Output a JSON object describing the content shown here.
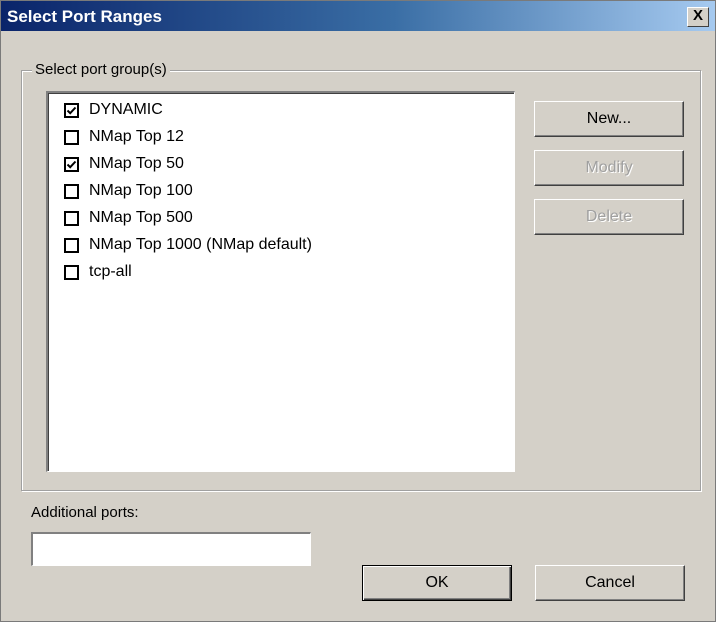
{
  "window": {
    "title": "Select Port Ranges",
    "close_label": "X"
  },
  "group": {
    "legend": "Select port group(s)",
    "items": [
      {
        "label": "DYNAMIC",
        "checked": true
      },
      {
        "label": "NMap Top 12",
        "checked": false
      },
      {
        "label": "NMap Top 50",
        "checked": true
      },
      {
        "label": "NMap Top 100",
        "checked": false
      },
      {
        "label": "NMap Top 500",
        "checked": false
      },
      {
        "label": "NMap Top 1000 (NMap default)",
        "checked": false
      },
      {
        "label": "tcp-all",
        "checked": false
      }
    ]
  },
  "side_buttons": {
    "new_label": "New...",
    "modify_label": "Modify",
    "delete_label": "Delete"
  },
  "additional_ports": {
    "label": "Additional ports:",
    "value": ""
  },
  "footer": {
    "ok_label": "OK",
    "cancel_label": "Cancel"
  }
}
